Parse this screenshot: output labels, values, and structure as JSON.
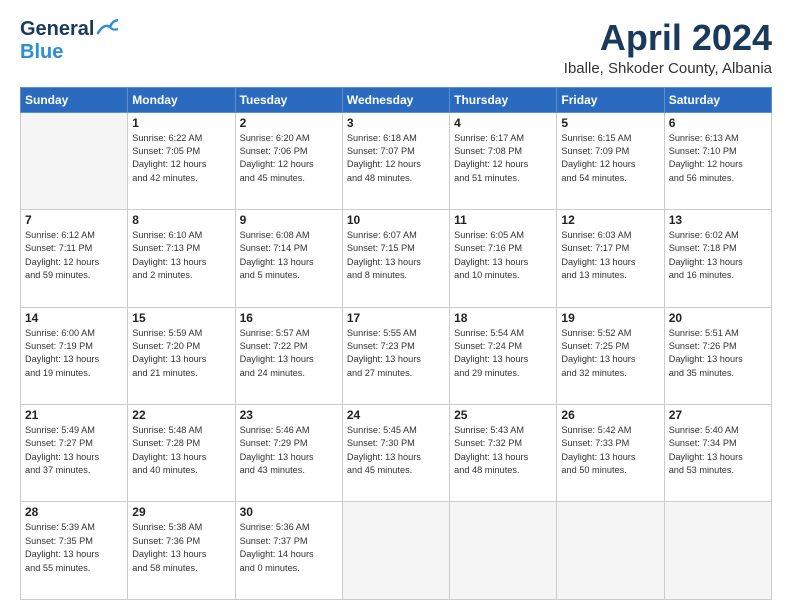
{
  "header": {
    "logo_general": "General",
    "logo_blue": "Blue",
    "month_title": "April 2024",
    "location": "Iballe, Shkoder County, Albania"
  },
  "weekdays": [
    "Sunday",
    "Monday",
    "Tuesday",
    "Wednesday",
    "Thursday",
    "Friday",
    "Saturday"
  ],
  "weeks": [
    [
      {
        "day": "",
        "info": ""
      },
      {
        "day": "1",
        "info": "Sunrise: 6:22 AM\nSunset: 7:05 PM\nDaylight: 12 hours\nand 42 minutes."
      },
      {
        "day": "2",
        "info": "Sunrise: 6:20 AM\nSunset: 7:06 PM\nDaylight: 12 hours\nand 45 minutes."
      },
      {
        "day": "3",
        "info": "Sunrise: 6:18 AM\nSunset: 7:07 PM\nDaylight: 12 hours\nand 48 minutes."
      },
      {
        "day": "4",
        "info": "Sunrise: 6:17 AM\nSunset: 7:08 PM\nDaylight: 12 hours\nand 51 minutes."
      },
      {
        "day": "5",
        "info": "Sunrise: 6:15 AM\nSunset: 7:09 PM\nDaylight: 12 hours\nand 54 minutes."
      },
      {
        "day": "6",
        "info": "Sunrise: 6:13 AM\nSunset: 7:10 PM\nDaylight: 12 hours\nand 56 minutes."
      }
    ],
    [
      {
        "day": "7",
        "info": "Sunrise: 6:12 AM\nSunset: 7:11 PM\nDaylight: 12 hours\nand 59 minutes."
      },
      {
        "day": "8",
        "info": "Sunrise: 6:10 AM\nSunset: 7:13 PM\nDaylight: 13 hours\nand 2 minutes."
      },
      {
        "day": "9",
        "info": "Sunrise: 6:08 AM\nSunset: 7:14 PM\nDaylight: 13 hours\nand 5 minutes."
      },
      {
        "day": "10",
        "info": "Sunrise: 6:07 AM\nSunset: 7:15 PM\nDaylight: 13 hours\nand 8 minutes."
      },
      {
        "day": "11",
        "info": "Sunrise: 6:05 AM\nSunset: 7:16 PM\nDaylight: 13 hours\nand 10 minutes."
      },
      {
        "day": "12",
        "info": "Sunrise: 6:03 AM\nSunset: 7:17 PM\nDaylight: 13 hours\nand 13 minutes."
      },
      {
        "day": "13",
        "info": "Sunrise: 6:02 AM\nSunset: 7:18 PM\nDaylight: 13 hours\nand 16 minutes."
      }
    ],
    [
      {
        "day": "14",
        "info": "Sunrise: 6:00 AM\nSunset: 7:19 PM\nDaylight: 13 hours\nand 19 minutes."
      },
      {
        "day": "15",
        "info": "Sunrise: 5:59 AM\nSunset: 7:20 PM\nDaylight: 13 hours\nand 21 minutes."
      },
      {
        "day": "16",
        "info": "Sunrise: 5:57 AM\nSunset: 7:22 PM\nDaylight: 13 hours\nand 24 minutes."
      },
      {
        "day": "17",
        "info": "Sunrise: 5:55 AM\nSunset: 7:23 PM\nDaylight: 13 hours\nand 27 minutes."
      },
      {
        "day": "18",
        "info": "Sunrise: 5:54 AM\nSunset: 7:24 PM\nDaylight: 13 hours\nand 29 minutes."
      },
      {
        "day": "19",
        "info": "Sunrise: 5:52 AM\nSunset: 7:25 PM\nDaylight: 13 hours\nand 32 minutes."
      },
      {
        "day": "20",
        "info": "Sunrise: 5:51 AM\nSunset: 7:26 PM\nDaylight: 13 hours\nand 35 minutes."
      }
    ],
    [
      {
        "day": "21",
        "info": "Sunrise: 5:49 AM\nSunset: 7:27 PM\nDaylight: 13 hours\nand 37 minutes."
      },
      {
        "day": "22",
        "info": "Sunrise: 5:48 AM\nSunset: 7:28 PM\nDaylight: 13 hours\nand 40 minutes."
      },
      {
        "day": "23",
        "info": "Sunrise: 5:46 AM\nSunset: 7:29 PM\nDaylight: 13 hours\nand 43 minutes."
      },
      {
        "day": "24",
        "info": "Sunrise: 5:45 AM\nSunset: 7:30 PM\nDaylight: 13 hours\nand 45 minutes."
      },
      {
        "day": "25",
        "info": "Sunrise: 5:43 AM\nSunset: 7:32 PM\nDaylight: 13 hours\nand 48 minutes."
      },
      {
        "day": "26",
        "info": "Sunrise: 5:42 AM\nSunset: 7:33 PM\nDaylight: 13 hours\nand 50 minutes."
      },
      {
        "day": "27",
        "info": "Sunrise: 5:40 AM\nSunset: 7:34 PM\nDaylight: 13 hours\nand 53 minutes."
      }
    ],
    [
      {
        "day": "28",
        "info": "Sunrise: 5:39 AM\nSunset: 7:35 PM\nDaylight: 13 hours\nand 55 minutes."
      },
      {
        "day": "29",
        "info": "Sunrise: 5:38 AM\nSunset: 7:36 PM\nDaylight: 13 hours\nand 58 minutes."
      },
      {
        "day": "30",
        "info": "Sunrise: 5:36 AM\nSunset: 7:37 PM\nDaylight: 14 hours\nand 0 minutes."
      },
      {
        "day": "",
        "info": ""
      },
      {
        "day": "",
        "info": ""
      },
      {
        "day": "",
        "info": ""
      },
      {
        "day": "",
        "info": ""
      }
    ]
  ]
}
